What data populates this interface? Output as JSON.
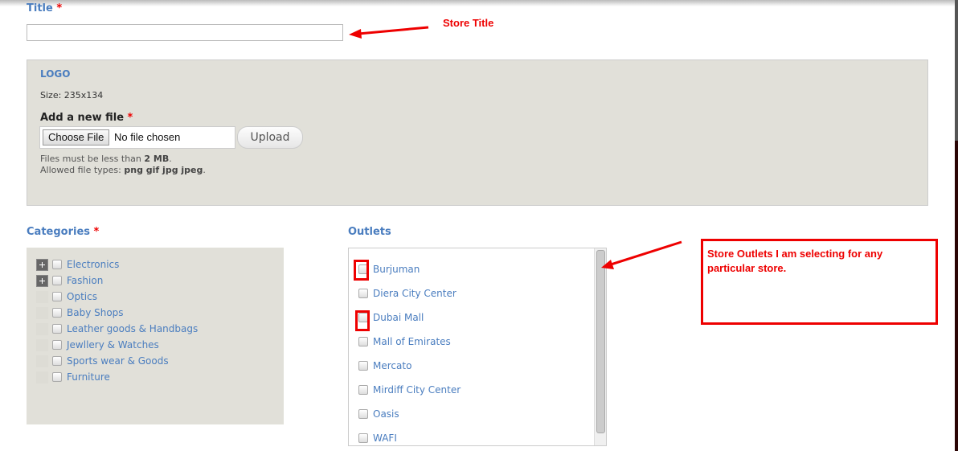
{
  "title_field": {
    "label": "Title",
    "required_mark": "*",
    "value": ""
  },
  "logo": {
    "legend": "LOGO",
    "size_text": "Size: 235x134",
    "add_file_label": "Add a new file",
    "required_mark": "*",
    "choose_file_label": "Choose File",
    "no_file_text": "No file chosen",
    "upload_label": "Upload",
    "help_size_prefix": "Files must be less than ",
    "help_size_value": "2 MB",
    "help_size_suffix": ".",
    "help_types_prefix": "Allowed file types: ",
    "help_types_value": "png gif jpg jpeg",
    "help_types_suffix": "."
  },
  "categories": {
    "label": "Categories",
    "required_mark": "*",
    "items": [
      {
        "label": "Electronics",
        "expandable": true,
        "checked": false
      },
      {
        "label": "Fashion",
        "expandable": true,
        "checked": false
      },
      {
        "label": "Optics",
        "expandable": false,
        "checked": false
      },
      {
        "label": "Baby Shops",
        "expandable": false,
        "checked": false
      },
      {
        "label": "Leather goods & Handbags",
        "expandable": false,
        "checked": false
      },
      {
        "label": "Jewllery & Watches",
        "expandable": false,
        "checked": false
      },
      {
        "label": "Sports wear & Goods",
        "expandable": false,
        "checked": false
      },
      {
        "label": "Furniture",
        "expandable": false,
        "checked": false
      }
    ]
  },
  "outlets": {
    "label": "Outlets",
    "items": [
      {
        "label": "Burjuman",
        "checked": false,
        "highlighted": true
      },
      {
        "label": "Diera City Center",
        "checked": false,
        "highlighted": false
      },
      {
        "label": "Dubai Mall",
        "checked": false,
        "highlighted": true
      },
      {
        "label": "Mall of Emirates",
        "checked": false,
        "highlighted": false
      },
      {
        "label": "Mercato",
        "checked": false,
        "highlighted": false
      },
      {
        "label": "Mirdiff City Center",
        "checked": false,
        "highlighted": false
      },
      {
        "label": "Oasis",
        "checked": false,
        "highlighted": false
      },
      {
        "label": "WAFI",
        "checked": false,
        "highlighted": false
      }
    ]
  },
  "annotations": {
    "store_title": "Store Title",
    "store_outlets": "Store Outlets I am selecting for any particular store.",
    "color": "#ee0000"
  },
  "colors": {
    "label_blue": "#4a7dbf",
    "panel_bg": "#e1e0d9"
  }
}
